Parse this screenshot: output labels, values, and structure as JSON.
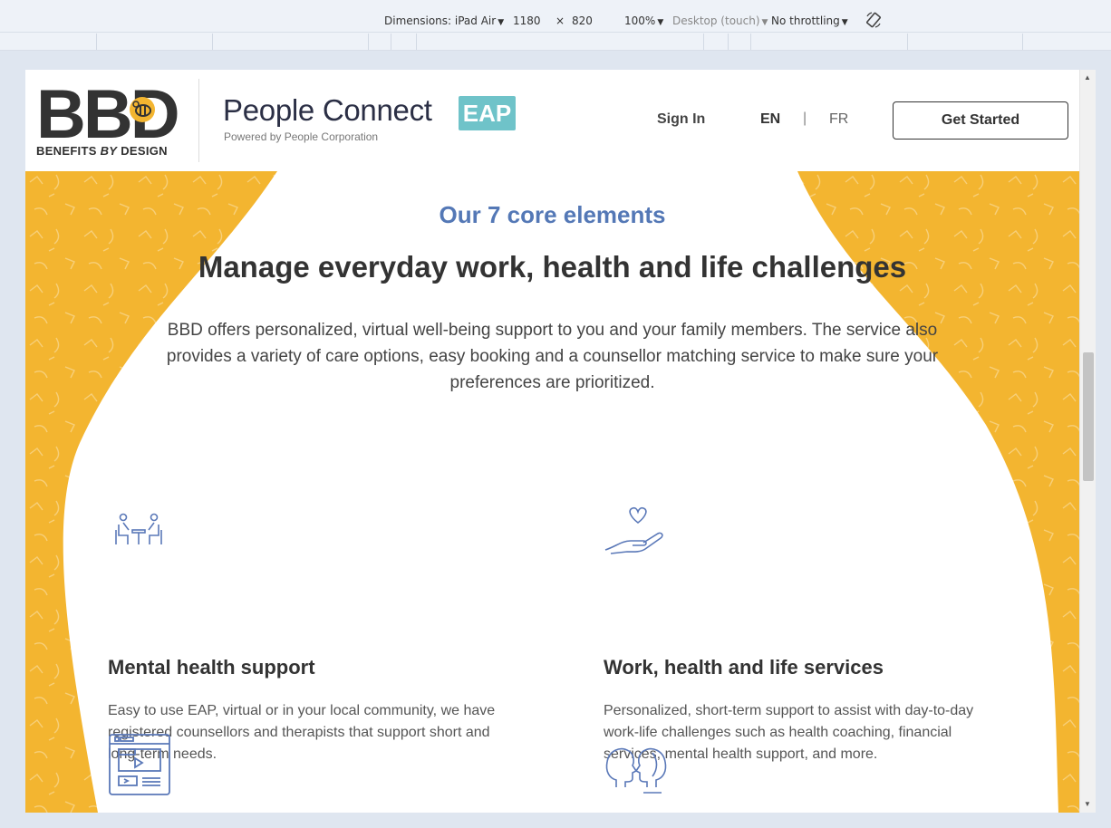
{
  "devtools": {
    "dimensions_label": "Dimensions: iPad Air",
    "width": "1180",
    "times": "×",
    "height": "820",
    "zoom": "100%",
    "device_type": "Desktop (touch)",
    "throttling": "No throttling"
  },
  "header": {
    "logo_letters": "BBD",
    "logo_tagline_a": "BENEFITS ",
    "logo_tagline_b": "BY",
    "logo_tagline_c": " DESIGN",
    "brand_title": "People Connect",
    "brand_badge": "EAP",
    "brand_sub": "Powered by People Corporation",
    "sign_in": "Sign In",
    "lang_en": "EN",
    "lang_sep": "|",
    "lang_fr": "FR",
    "cta": "Get Started"
  },
  "section": {
    "eyebrow": "Our 7 core elements",
    "headline": "Manage everyday work, health and life challenges",
    "intro": "BBD offers personalized, virtual well-being support to you and your family members. The service also provides a variety of care options, easy booking and a counsellor matching service to make sure your preferences are prioritized."
  },
  "cards": [
    {
      "icon": "counselling-session-icon",
      "title": "Mental health support",
      "text": "Easy to use EAP, virtual or in your local community, we have registered counsellors and therapists that support short and long-term needs."
    },
    {
      "icon": "heart-in-hand-icon",
      "title": "Work, health and life services",
      "text": "Personalized, short-term support to assist with day-to-day work-life challenges such as health coaching, financial services, mental health support, and more."
    },
    {
      "icon": "video-content-icon"
    },
    {
      "icon": "two-heads-icon"
    }
  ],
  "colors": {
    "accent_yellow": "#f3b530",
    "eyebrow_blue": "#5478b6",
    "badge_teal": "#6fc3c9",
    "icon_blue": "#5a78b8"
  }
}
